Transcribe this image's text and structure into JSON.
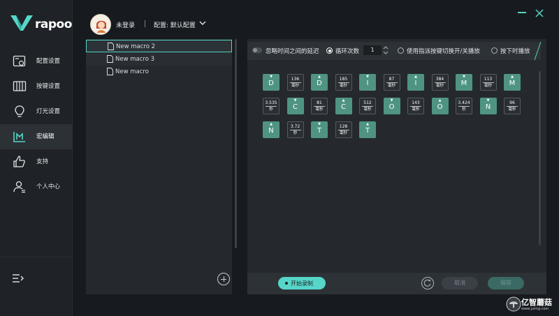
{
  "app": {
    "brand": "rapoo"
  },
  "header": {
    "login_status": "未登录",
    "profile_label": "配置: 默认配置"
  },
  "sidebar": {
    "items": [
      {
        "label": "配置设置",
        "icon": "config-icon"
      },
      {
        "label": "按键设置",
        "icon": "keys-icon"
      },
      {
        "label": "灯光设置",
        "icon": "bulb-icon"
      },
      {
        "label": "宏编辑",
        "icon": "macro-icon",
        "active": true
      },
      {
        "label": "支持",
        "icon": "thumbs-up-icon"
      },
      {
        "label": "个人中心",
        "icon": "user-icon"
      }
    ]
  },
  "macro_list": {
    "items": [
      {
        "name": "New macro 2",
        "selected": true
      },
      {
        "name": "New macro 3"
      },
      {
        "name": "New macro"
      }
    ]
  },
  "options": {
    "ignore_delay": "忽略时间之间的延迟",
    "loop_label": "循环次数",
    "loop_value": "1",
    "toggle_label": "使用指派按键切换开/关播放",
    "hold_label": "按下时播放"
  },
  "blocks": [
    {
      "type": "key",
      "dir": "down",
      "key": "D"
    },
    {
      "type": "delay",
      "value": "136",
      "unit": "毫秒"
    },
    {
      "type": "key",
      "dir": "up",
      "key": "D"
    },
    {
      "type": "delay",
      "value": "185",
      "unit": "毫秒"
    },
    {
      "type": "key",
      "dir": "down",
      "key": "I"
    },
    {
      "type": "delay",
      "value": "87",
      "unit": "毫秒"
    },
    {
      "type": "key",
      "dir": "up",
      "key": "I"
    },
    {
      "type": "delay",
      "value": "384",
      "unit": "毫秒"
    },
    {
      "type": "key",
      "dir": "down",
      "key": "M"
    },
    {
      "type": "delay",
      "value": "113",
      "unit": "毫秒"
    },
    {
      "type": "key",
      "dir": "up",
      "key": "M"
    },
    {
      "type": "delay",
      "value": "3.535",
      "unit": "秒"
    },
    {
      "type": "key",
      "dir": "down",
      "key": "C"
    },
    {
      "type": "delay",
      "value": "81",
      "unit": "毫秒"
    },
    {
      "type": "key",
      "dir": "up",
      "key": "C"
    },
    {
      "type": "delay",
      "value": "512",
      "unit": "毫秒"
    },
    {
      "type": "key",
      "dir": "down",
      "key": "O"
    },
    {
      "type": "delay",
      "value": "143",
      "unit": "毫秒"
    },
    {
      "type": "key",
      "dir": "up",
      "key": "O"
    },
    {
      "type": "delay",
      "value": "3.424",
      "unit": "秒"
    },
    {
      "type": "key",
      "dir": "down",
      "key": "N"
    },
    {
      "type": "delay",
      "value": "96",
      "unit": "毫秒"
    },
    {
      "type": "key",
      "dir": "up",
      "key": "N"
    },
    {
      "type": "delay",
      "value": "3.72",
      "unit": "秒"
    },
    {
      "type": "key",
      "dir": "down",
      "key": "T"
    },
    {
      "type": "delay",
      "value": "128",
      "unit": "毫秒"
    },
    {
      "type": "key",
      "dir": "up",
      "key": "T"
    }
  ],
  "actions": {
    "record": "开始录制",
    "cancel": "取消",
    "save": "保存"
  },
  "watermark": {
    "title": "亿智蘑菇",
    "url": "www.yzmg.com"
  },
  "colors": {
    "accent": "#56d6c8",
    "key_block": "#4f9483",
    "background": "#171a1e"
  }
}
